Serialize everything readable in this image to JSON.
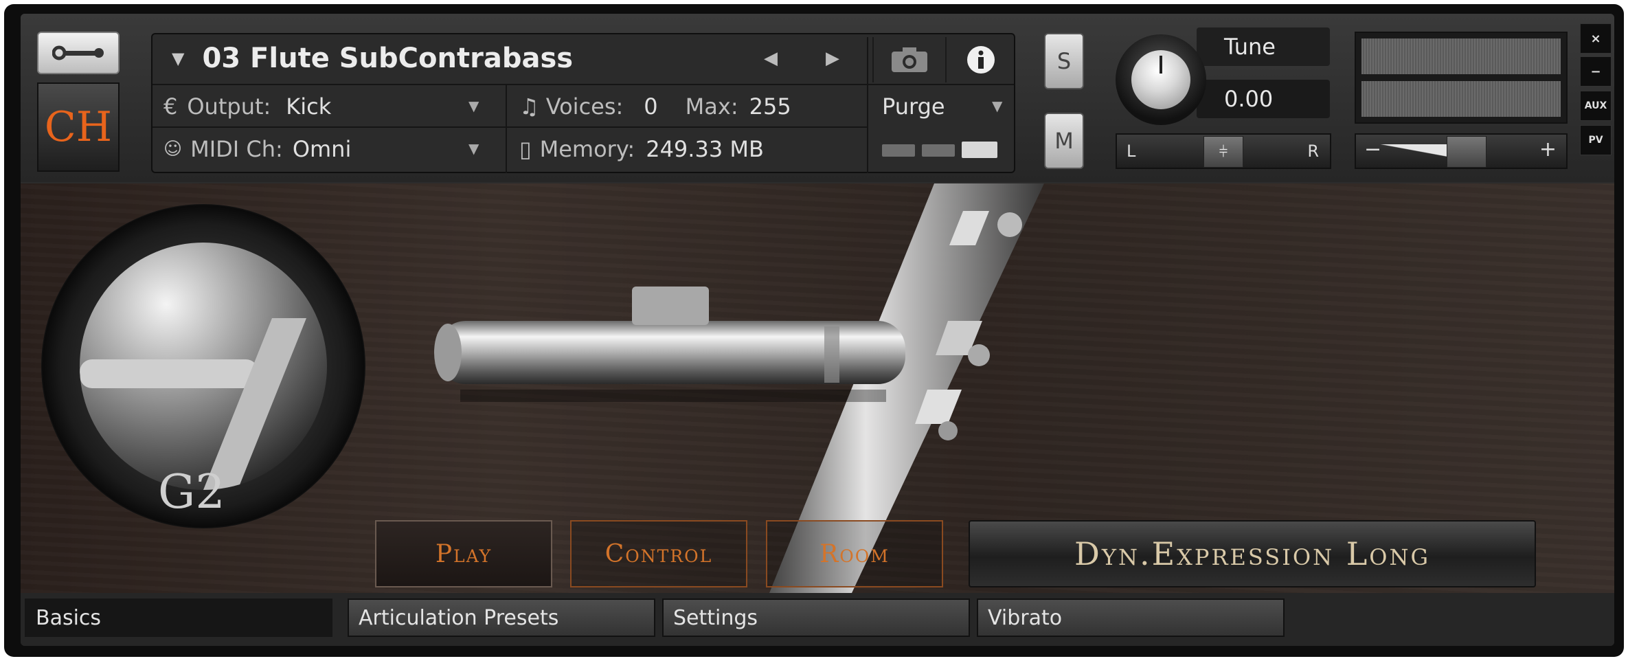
{
  "instrument": {
    "name": "03 Flute SubContrabass",
    "logo_text": "CH",
    "output_label": "Output:",
    "output_value": "Kick",
    "midi_label": "MIDI Ch:",
    "midi_value": "Omni",
    "voices_label": "Voices:",
    "voices_value": "0",
    "max_label": "Max:",
    "max_value": "255",
    "memory_label": "Memory:",
    "memory_value": "249.33 MB",
    "purge_label": "Purge"
  },
  "controls": {
    "solo_label": "S",
    "mute_label": "M",
    "tune_label": "Tune",
    "tune_value": "0.00",
    "pan_left": "L",
    "pan_right": "R",
    "vol_minus": "−",
    "vol_plus": "+",
    "close_label": "×",
    "minimize_label": "−",
    "aux_label": "AUX",
    "pv_label": "PV"
  },
  "main": {
    "note_name": "G2",
    "nav": {
      "play": "Play",
      "control": "Control",
      "room": "Room"
    },
    "articulation": "Dyn.Expression Long"
  },
  "tabs": [
    "Basics",
    "Articulation Presets",
    "Settings",
    "Vibrato"
  ],
  "colors": {
    "accent_orange": "#d4742a",
    "logo_orange": "#e8641c",
    "articulation_text": "#d9c9a8"
  }
}
